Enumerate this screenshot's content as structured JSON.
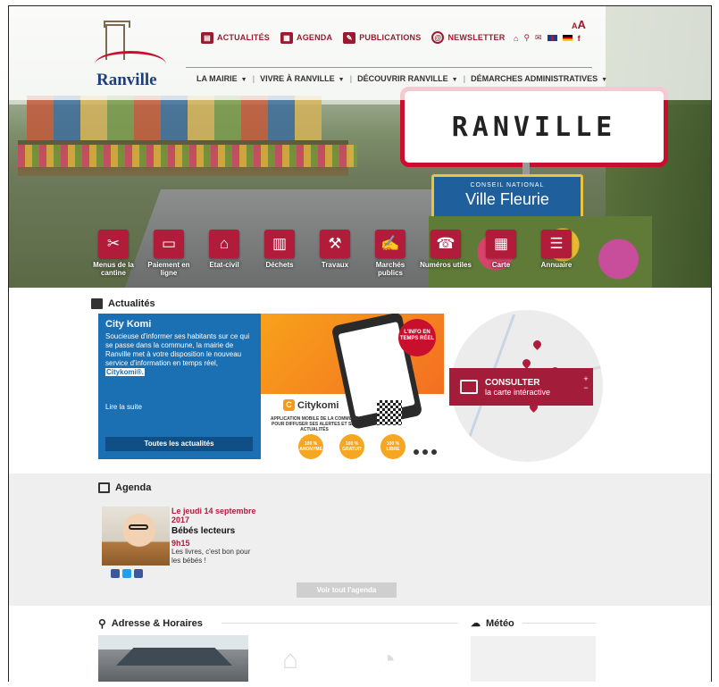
{
  "header": {
    "logo_text": "Ranville",
    "font_small": "A",
    "font_big": "A",
    "top_links": [
      {
        "label": "ACTUALITÉS",
        "icon": "newspaper-icon"
      },
      {
        "label": "AGENDA",
        "icon": "calendar-icon"
      },
      {
        "label": "PUBLICATIONS",
        "icon": "edit-icon"
      },
      {
        "label": "NEWSLETTER",
        "icon": "at-icon"
      }
    ],
    "main_nav": [
      "LA MAIRIE",
      "VIVRE À RANVILLE",
      "DÉCOUVRIR RANVILLE",
      "DÉMARCHES ADMINISTRATIVES"
    ]
  },
  "hero": {
    "sign_main": "RANVILLE",
    "sign_small": "CONSEIL NATIONAL",
    "sign_big": "Ville Fleurie"
  },
  "quick_links": [
    {
      "label": "Menus de la cantine",
      "icon": "cutlery-icon"
    },
    {
      "label": "Paiement en ligne",
      "icon": "payment-icon"
    },
    {
      "label": "Etat-civil",
      "icon": "townhall-icon"
    },
    {
      "label": "Déchets",
      "icon": "trash-icon"
    },
    {
      "label": "Travaux",
      "icon": "roadworks-icon"
    },
    {
      "label": "Marchés publics",
      "icon": "handshake-icon"
    },
    {
      "label": "Numéros utiles",
      "icon": "phone-icon"
    },
    {
      "label": "Carte",
      "icon": "map-icon"
    },
    {
      "label": "Annuaire",
      "icon": "list-icon"
    }
  ],
  "news": {
    "section_title": "Actualités",
    "title": "City Komi",
    "body": "Soucieuse d'informer ses habitants sur ce qui se passe dans la commune, la mairie de Ranville met à votre disposition le nouveau service d'information en temps réel,",
    "highlight": "Citykomi®.",
    "more": "Lire la suite",
    "all_button": "Toutes les actualités",
    "promo_badge": "L'INFO EN TEMPS RÉEL",
    "promo_logo": "Citykomi",
    "promo_sub": "APPLICATION MOBILE DE LA COMMUNE POUR DIFFUSER SES ALERTES ET SES ACTUALITÉS",
    "promo_circles": [
      "100 % ANONYME",
      "100 % GRATUIT",
      "100 % LIBRE"
    ]
  },
  "map": {
    "title": "CONSULTER",
    "subtitle": "la carte intéractive",
    "zoom_in": "+",
    "zoom_out": "−"
  },
  "agenda": {
    "section_title": "Agenda",
    "date": "Le jeudi 14 septembre 2017",
    "title": "Bébés lecteurs",
    "time": "9h15",
    "desc": "Les livres, c'est bon pour les bébés !",
    "all_button": "Voir tout l'agenda"
  },
  "bottom": {
    "address_title": "Adresse & Horaires",
    "meteo_title": "Météo"
  }
}
